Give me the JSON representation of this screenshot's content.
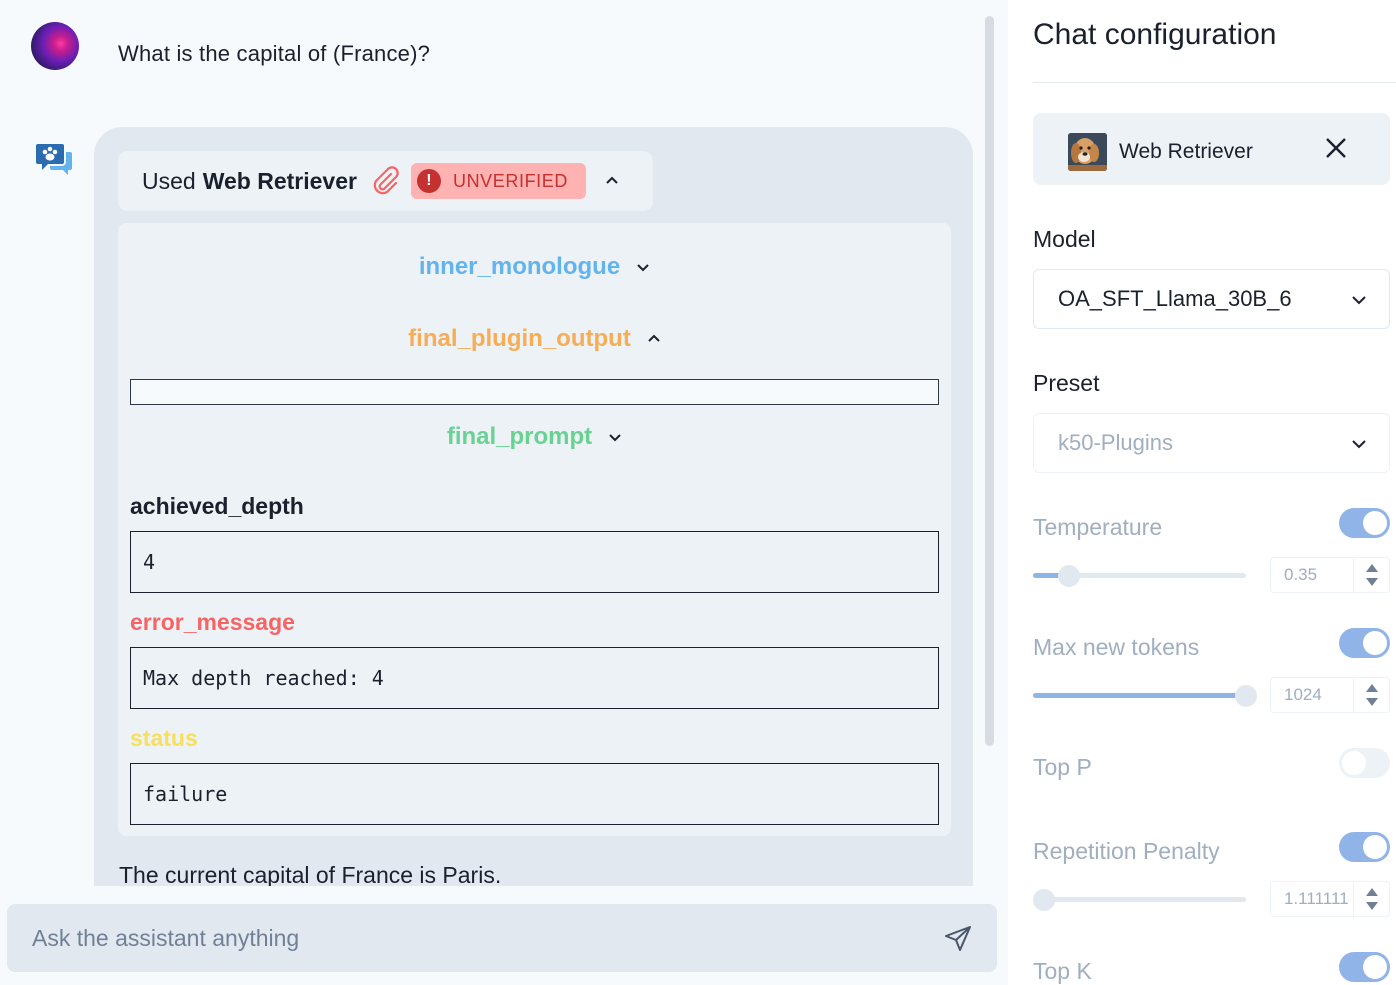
{
  "chat": {
    "user_message": "What is the capital of (France)?",
    "plugin_header": {
      "used_prefix": "Used",
      "plugin_name": "Web Retriever",
      "badge": "UNVERIFIED",
      "badge_icon": "!"
    },
    "sections": {
      "inner_monologue": "inner_monologue",
      "final_plugin_output": "final_plugin_output",
      "final_prompt": "final_prompt"
    },
    "fields": {
      "achieved_depth_label": "achieved_depth",
      "achieved_depth_value": "4",
      "error_message_label": "error_message",
      "error_message_value": "Max depth reached: 4",
      "status_label": "status",
      "status_value": "failure"
    },
    "answer": "The current capital of France is Paris.",
    "input_placeholder": "Ask the assistant anything"
  },
  "config": {
    "title": "Chat configuration",
    "plugin_name": "Web Retriever",
    "model_label": "Model",
    "model_value": "OA_SFT_Llama_30B_6",
    "preset_label": "Preset",
    "preset_value": "k50-Plugins",
    "temperature": {
      "label": "Temperature",
      "enabled": true,
      "value": "0.35",
      "fraction": 0.17
    },
    "max_new_tokens": {
      "label": "Max new tokens",
      "enabled": true,
      "value": "1024",
      "fraction": 1.0
    },
    "top_p": {
      "label": "Top P",
      "enabled": false
    },
    "repetition_penalty": {
      "label": "Repetition Penalty",
      "enabled": true,
      "value": "1.111111",
      "fraction": 0.05
    },
    "top_k": {
      "label": "Top K",
      "enabled": true
    }
  },
  "colors": {
    "inner_monologue": "#63b3ed",
    "final_plugin_output": "#f6ad55",
    "final_prompt": "#68d391",
    "error_message": "#f56565",
    "status": "#f6e05e",
    "badge_bg": "#feb2b2",
    "badge_text": "#c53030",
    "toggle_on": "#90b4e8"
  },
  "icons": [
    "user-avatar",
    "bot-chat-icon",
    "paperclip-icon",
    "warning-icon",
    "chevron-up-icon",
    "chevron-down-icon",
    "send-icon",
    "close-icon",
    "dog-plugin-icon"
  ]
}
